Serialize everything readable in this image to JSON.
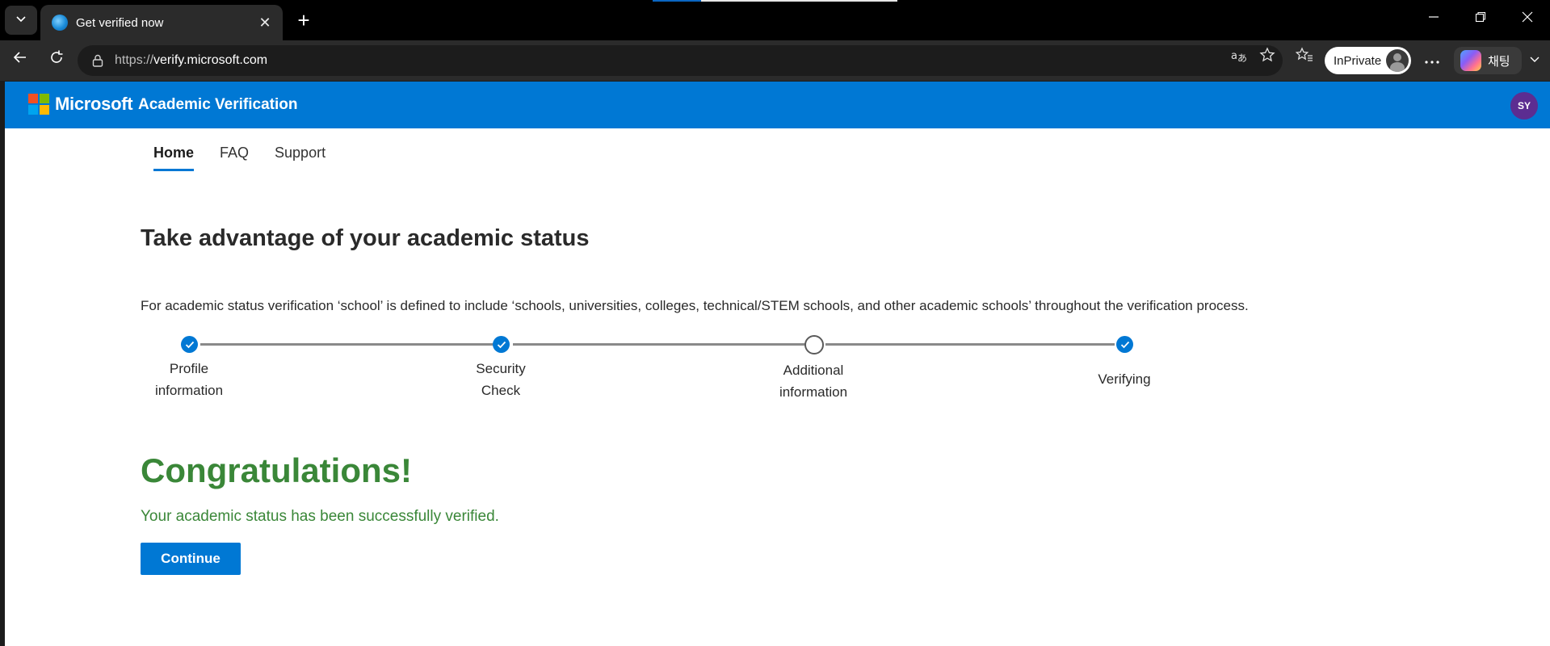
{
  "browser": {
    "tab": {
      "title": "Get verified now"
    },
    "url": {
      "protocol": "https://",
      "host": "verify.microsoft.com"
    },
    "inprivate_label": "InPrivate",
    "copilot_label": "채팅",
    "icons": {
      "tab_list": "chevron-down-icon",
      "close_tab": "close-icon",
      "new_tab": "plus-icon",
      "back": "back-arrow-icon",
      "refresh": "refresh-icon",
      "site_info": "lock-icon",
      "translate": "translate-icon",
      "favorite": "star-icon",
      "favorites_list": "favorites-icon",
      "more": "ellipsis-icon"
    }
  },
  "header": {
    "brand": "Microsoft",
    "app_title": "Academic Verification",
    "user_initials": "SY",
    "colors": {
      "bar": "#0078d4",
      "avatar": "#5c2d91"
    }
  },
  "nav": {
    "items": [
      {
        "label": "Home",
        "active": true
      },
      {
        "label": "FAQ",
        "active": false
      },
      {
        "label": "Support",
        "active": false
      }
    ]
  },
  "main": {
    "heading": "Take advantage of your academic status",
    "definition": "For academic status verification ‘school’ is defined to include ‘schools, universities, colleges, technical/STEM schools, and other academic schools’ throughout the verification process.",
    "steps": [
      {
        "line1": "Profile",
        "line2": "information",
        "state": "complete"
      },
      {
        "line1": "Security",
        "line2": "Check",
        "state": "complete"
      },
      {
        "line1": "Additional",
        "line2": "information",
        "state": "pending"
      },
      {
        "line1": "Verifying",
        "line2": "",
        "state": "complete"
      }
    ],
    "success_title": "Congratulations!",
    "success_message": "Your academic status has been successfully verified.",
    "continue_label": "Continue",
    "colors": {
      "success": "#3a8738",
      "primary": "#0078d4"
    }
  }
}
